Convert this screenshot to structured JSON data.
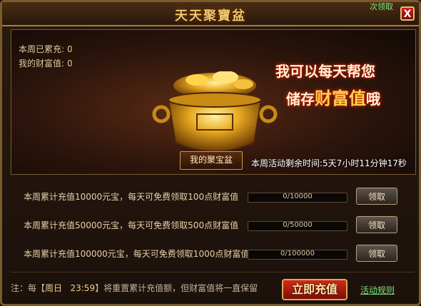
{
  "window": {
    "title": "天天聚寶盆",
    "corner_tag": "次领取",
    "close_symbol": "X"
  },
  "stats": {
    "weekly_recharge_label": "本周已累充:",
    "weekly_recharge_value": "0",
    "wealth_label": "我的财富值:",
    "wealth_value": "0"
  },
  "banner": {
    "tagline_line1": "我可以每天帮您",
    "tagline_line2_prefix": "储存",
    "tagline_line2_emph": "财富值",
    "tagline_line2_suffix": "哦",
    "my_pot_button": "我的聚宝盆",
    "countdown_label": "本周活动剩余时间:",
    "countdown_value": "5天7小时11分钟17秒"
  },
  "rewards": [
    {
      "text": "本周累计充值10000元宝，每天可免费领取100点财富值",
      "progress_text": "0/10000",
      "progress": 0,
      "button": "领取"
    },
    {
      "text": "本周累计充值50000元宝，每天可免费领取500点财富值",
      "progress_text": "0/50000",
      "progress": 0,
      "button": "领取"
    },
    {
      "text": "本周累计充值100000元宝，每天可免费领取1000点财富值",
      "progress_text": "0/100000",
      "progress": 0,
      "button": "领取"
    }
  ],
  "footer": {
    "note_prefix": "注：每【",
    "note_day": "周日",
    "note_time": "23:59",
    "note_suffix": "】将重置累计充值额，但财富值将一直保留",
    "recharge_button": "立即充值",
    "rules_link": "活动规则"
  },
  "colors": {
    "accent_gold": "#f3c86a",
    "recharge_red": "#d42a1b",
    "link_green": "#7be37e"
  }
}
